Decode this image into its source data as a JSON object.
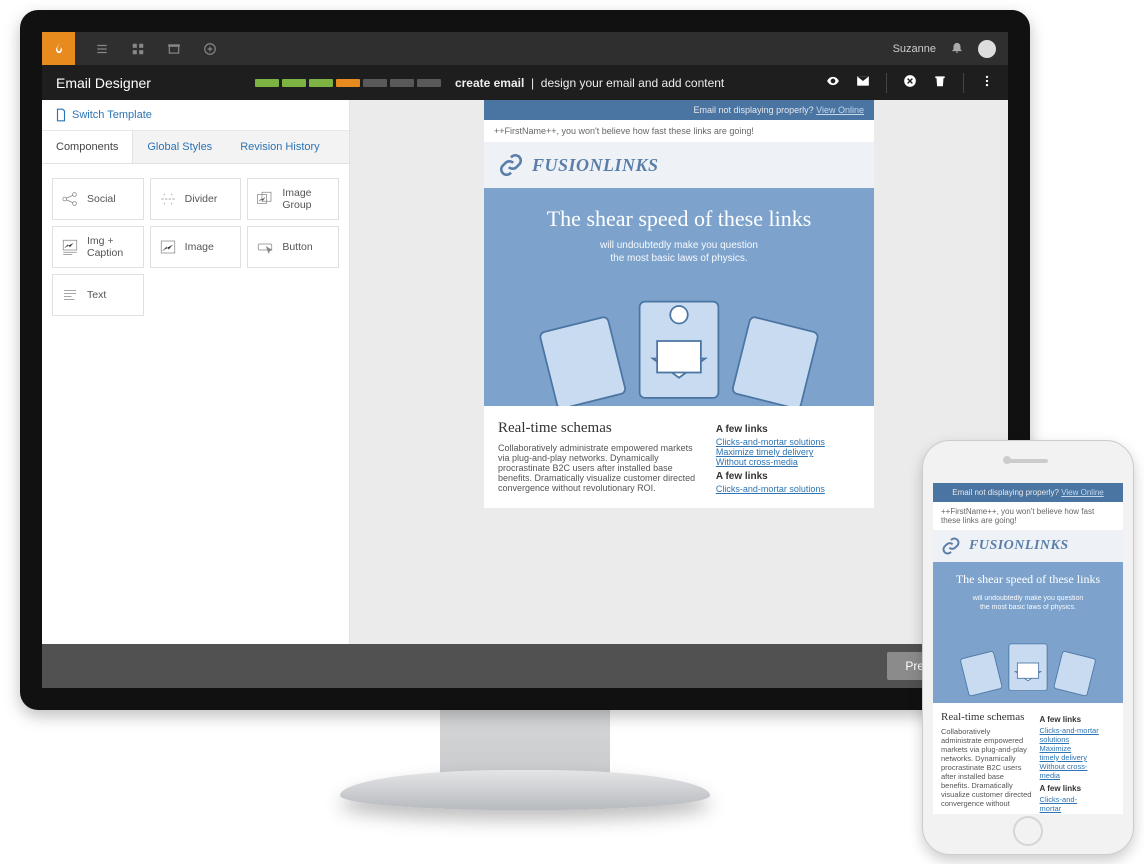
{
  "top": {
    "user": "Suzanne"
  },
  "title": {
    "app": "Email Designer",
    "step_bold": "create email",
    "step_sep": "|",
    "step_desc": "design your email and add content"
  },
  "sidebar": {
    "switch": "Switch Template",
    "tabs": [
      "Components",
      "Global Styles",
      "Revision History"
    ],
    "components": [
      "Social",
      "Divider",
      "Image Group",
      "Img + Caption",
      "Image",
      "Button",
      "Text"
    ]
  },
  "email": {
    "banner_q": "Email not displaying properly?",
    "banner_link": "View Online",
    "preheader": "++FirstName++, you won't believe how fast these links are going!",
    "brand": "FUSIONLINKS",
    "hero_h1": "The shear speed of these links",
    "hero_l1": "will undoubtedly make you question",
    "hero_l2": "the most basic laws of physics.",
    "article_h2": "Real-time schemas",
    "article_p": "Collaboratively administrate empowered markets via plug-and-play networks. Dynamically procrastinate B2C users after installed base benefits. Dramatically visualize customer directed convergence without revolutionary ROI.",
    "side_h1": "A few links",
    "side_l1": "Clicks-and-mortar solutions",
    "side_l2": "Maximize timely delivery",
    "side_l3": "Without cross-media",
    "side_h2": "A few links",
    "side_l4": "Clicks-and-mortar solutions"
  },
  "phone": {
    "preheader": "++FirstName++, you won't believe how fast these links are going!",
    "article_p": "Collaboratively administrate empowered markets via plug-and-play networks. Dynamically procrastinate B2C users after installed base benefits. Dramatically visualize customer directed convergence without",
    "side_l1a": "Clicks-and-mortar",
    "side_l1b": "solutions",
    "side_l2a": "Maximize",
    "side_l2b": "timely delivery",
    "side_l3a": "Without cross-",
    "side_l3b": "media",
    "side_l4a": "Clicks-and-",
    "side_l4b": "mortar"
  },
  "footer": {
    "prev": "Previous"
  }
}
